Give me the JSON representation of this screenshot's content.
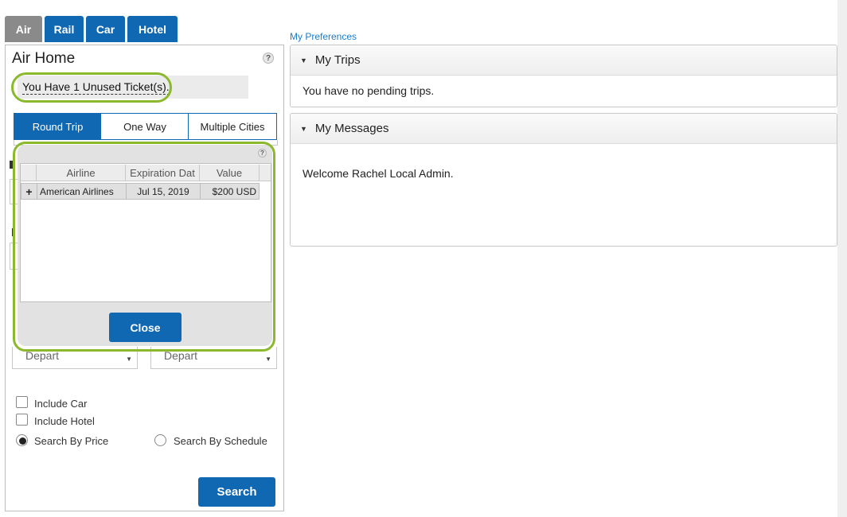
{
  "tabs": {
    "items": [
      {
        "label": "Air",
        "active": true
      },
      {
        "label": "Rail",
        "active": false
      },
      {
        "label": "Car",
        "active": false
      },
      {
        "label": "Hotel",
        "active": false
      }
    ]
  },
  "air_home": {
    "title": "Air Home",
    "help_glyph": "?",
    "unused_tickets_link": "You Have 1 Unused Ticket(s).",
    "trip_types": [
      "Round Trip",
      "One Way",
      "Multiple Cities"
    ],
    "selected_trip_type": "Round Trip",
    "depart_left": "Depart",
    "depart_right": "Depart",
    "options": {
      "include_car": "Include Car",
      "include_hotel": "Include Hotel",
      "search_by_price": "Search By Price",
      "search_by_schedule": "Search By Schedule",
      "selected_search_mode": "Search By Price"
    },
    "search_button": "Search"
  },
  "unused_tickets_popup": {
    "help_glyph": "?",
    "columns": [
      "Airline",
      "Expiration Dat",
      "Value"
    ],
    "rows": [
      {
        "expand": "+",
        "airline": "American Airlines",
        "expiration": "Jul 15, 2019",
        "value": "$200 USD"
      }
    ],
    "close_button": "Close"
  },
  "my_preferences_link": "My Preferences",
  "my_trips": {
    "title": "My Trips",
    "message": "You have no pending trips."
  },
  "my_messages": {
    "title": "My Messages",
    "message": "Welcome Rachel Local Admin."
  },
  "colors": {
    "brand_blue": "#1067b2",
    "active_tab_gray": "#8a8a8a",
    "highlight_green": "#8ab92d",
    "link_blue": "#1e7bc7"
  }
}
